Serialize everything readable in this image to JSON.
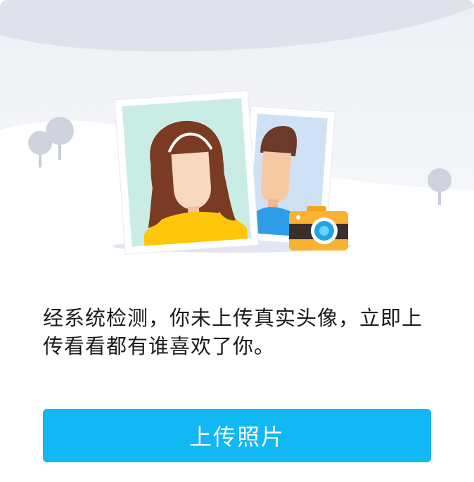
{
  "dialog": {
    "message": "经系统检测，你未上传真实头像，立即上传看看都有谁喜欢了你。",
    "upload_button_label": "上传照片"
  },
  "colors": {
    "accent": "#12b7f5",
    "text": "#1a1a1a",
    "background": "#ffffff",
    "hill": "#e8ebf2"
  },
  "illustration": {
    "icons": [
      "tree-icon",
      "girl-photo",
      "boy-photo",
      "camera-icon"
    ]
  }
}
